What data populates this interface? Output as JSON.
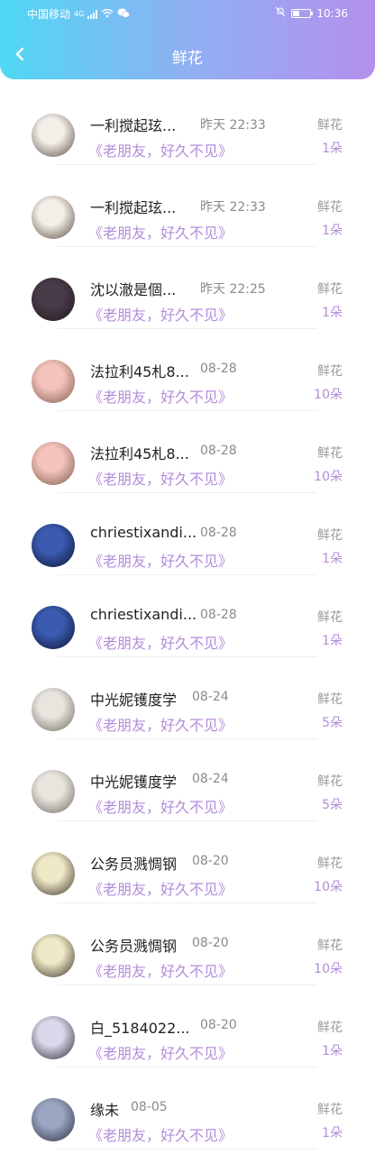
{
  "status_bar": {
    "carrier": "中国移动",
    "network": "4G",
    "time": "10:36"
  },
  "header": {
    "title": "鲜花"
  },
  "items": [
    {
      "name": "一利搅起玹...",
      "time": "昨天 22:33",
      "message": "《老朋友，好久不见》",
      "gift": "鲜花",
      "count": "1朵",
      "avatar_colors": [
        "#f2efe8",
        "#5c4a42"
      ]
    },
    {
      "name": "一利搅起玹...",
      "time": "昨天 22:33",
      "message": "《老朋友，好久不见》",
      "gift": "鲜花",
      "count": "1朵",
      "avatar_colors": [
        "#f2efe8",
        "#5c4a42"
      ]
    },
    {
      "name": "沈以澈是個...",
      "time": "昨天 22:25",
      "message": "《老朋友，好久不见》",
      "gift": "鲜花",
      "count": "1朵",
      "avatar_colors": [
        "#4a3b49",
        "#1d1719"
      ]
    },
    {
      "name": "法拉利45札8...",
      "time": "08-28",
      "message": "《老朋友，好久不见》",
      "gift": "鲜花",
      "count": "10朵",
      "avatar_colors": [
        "#f4c3bb",
        "#7a5a4c"
      ]
    },
    {
      "name": "法拉利45札8...",
      "time": "08-28",
      "message": "《老朋友，好久不见》",
      "gift": "鲜花",
      "count": "10朵",
      "avatar_colors": [
        "#f4c3bb",
        "#7a5a4c"
      ]
    },
    {
      "name": "chriestixandi...",
      "time": "08-28",
      "message": "《老朋友，好久不见》",
      "gift": "鲜花",
      "count": "1朵",
      "avatar_colors": [
        "#3b5bb0",
        "#0a1330"
      ]
    },
    {
      "name": "chriestixandi...",
      "time": "08-28",
      "message": "《老朋友，好久不见》",
      "gift": "鲜花",
      "count": "1朵",
      "avatar_colors": [
        "#3b5bb0",
        "#0a1330"
      ]
    },
    {
      "name": "中光妮镬度学",
      "time": "08-24",
      "message": "《老朋友，好久不见》",
      "gift": "鲜花",
      "count": "5朵",
      "avatar_colors": [
        "#e8e5df",
        "#6f6860"
      ]
    },
    {
      "name": "中光妮镬度学",
      "time": "08-24",
      "message": "《老朋友，好久不见》",
      "gift": "鲜花",
      "count": "5朵",
      "avatar_colors": [
        "#e8e5df",
        "#6f6860"
      ]
    },
    {
      "name": "公务员溅惆钢",
      "time": "08-20",
      "message": "《老朋友，好久不见》",
      "gift": "鲜花",
      "count": "10朵",
      "avatar_colors": [
        "#f0e9c7",
        "#3a3128"
      ]
    },
    {
      "name": "公务员溅惆钢",
      "time": "08-20",
      "message": "《老朋友，好久不见》",
      "gift": "鲜花",
      "count": "10朵",
      "avatar_colors": [
        "#f0e9c7",
        "#3a3128"
      ]
    },
    {
      "name": "白_5184022...",
      "time": "08-20",
      "message": "《老朋友，好久不见》",
      "gift": "鲜花",
      "count": "1朵",
      "avatar_colors": [
        "#dcd7ea",
        "#2b2a3a"
      ]
    },
    {
      "name": "缘未",
      "time": "08-05",
      "message": "《老朋友，好久不见》",
      "gift": "鲜花",
      "count": "1朵",
      "avatar_colors": [
        "#9aa6c2",
        "#2e2f40"
      ]
    }
  ],
  "icons": {
    "back": "chevron-left-icon"
  },
  "colors": {
    "accent": "#b38cdb",
    "header_start": "#4fd8f4",
    "header_end": "#b490ee"
  }
}
